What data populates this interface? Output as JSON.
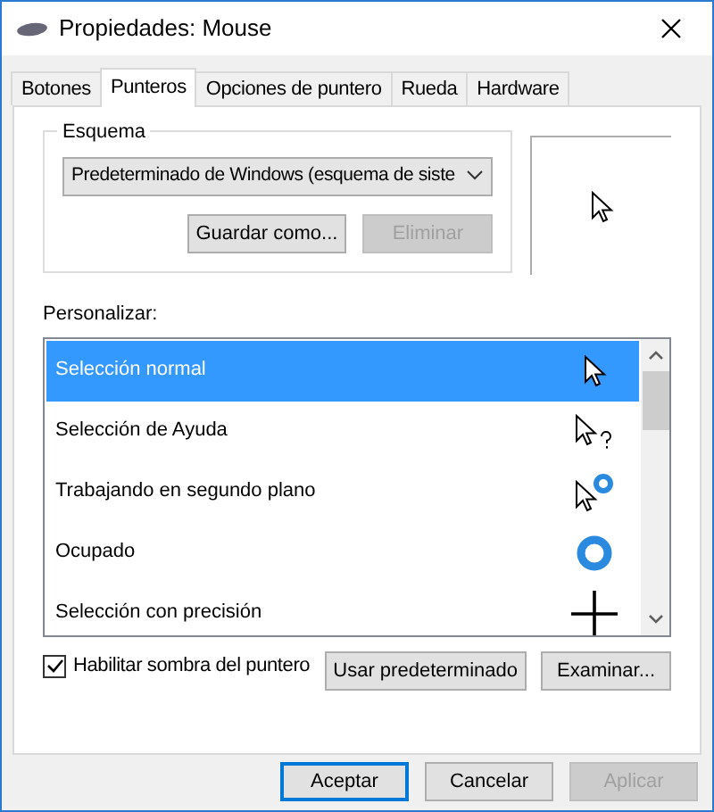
{
  "window": {
    "title": "Propiedades: Mouse"
  },
  "tabs": [
    {
      "label": "Botones",
      "selected": false
    },
    {
      "label": "Punteros",
      "selected": true
    },
    {
      "label": "Opciones de puntero",
      "selected": false
    },
    {
      "label": "Rueda",
      "selected": false
    },
    {
      "label": "Hardware",
      "selected": false
    }
  ],
  "scheme": {
    "label": "Esquema",
    "value": "Predeterminado de Windows (esquema de siste",
    "buttons": [
      {
        "label": "Guardar como...",
        "disabled": false
      },
      {
        "label": "Eliminar",
        "disabled": true
      }
    ]
  },
  "customize": {
    "label": "Personalizar:",
    "items": [
      {
        "name": "Selección normal",
        "kind": "arrow",
        "selected": true
      },
      {
        "name": "Selección de Ayuda",
        "kind": "help",
        "selected": false
      },
      {
        "name": "Trabajando en segundo plano",
        "kind": "working",
        "selected": false
      },
      {
        "name": "Ocupado",
        "kind": "busy",
        "selected": false
      },
      {
        "name": "Selección con precisión",
        "kind": "cross",
        "selected": false
      }
    ]
  },
  "shadow": {
    "label": "Habilitar sombra del puntero",
    "checked": true
  },
  "pointer_buttons": [
    {
      "label": "Usar predeterminado"
    },
    {
      "label": "Examinar..."
    }
  ],
  "footer_buttons": [
    {
      "label": "Aceptar",
      "default": true,
      "disabled": false
    },
    {
      "label": "Cancelar",
      "default": false,
      "disabled": false
    },
    {
      "label": "Aplicar",
      "default": false,
      "disabled": true
    }
  ]
}
